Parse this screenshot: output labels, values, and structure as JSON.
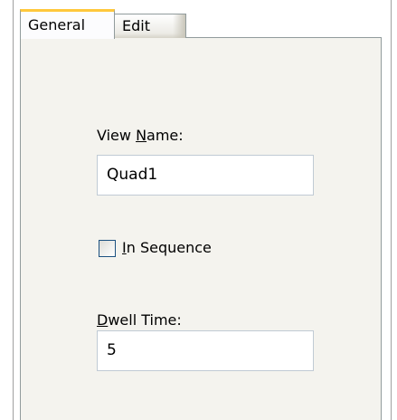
{
  "tabs": [
    {
      "label": "General",
      "active": true
    },
    {
      "label": "Edit",
      "active": false
    }
  ],
  "view_name": {
    "label_prefix": "View ",
    "label_accel": "N",
    "label_rest": "ame:",
    "value": "Quad1"
  },
  "in_sequence": {
    "accel": "I",
    "label_rest": "n Sequence",
    "checked": false
  },
  "dwell_time": {
    "label_accel": "D",
    "label_rest": "well Time:",
    "value": "5"
  }
}
